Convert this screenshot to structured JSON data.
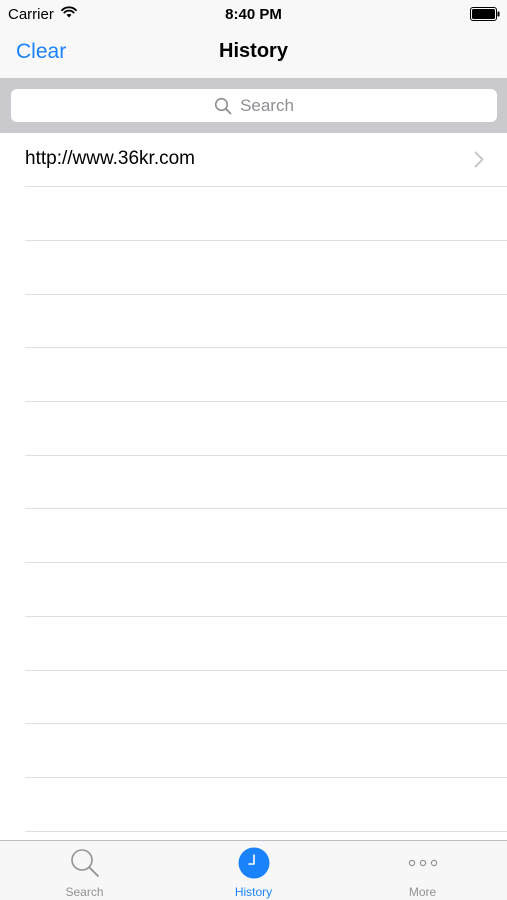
{
  "status_bar": {
    "carrier": "Carrier",
    "time": "8:40 PM"
  },
  "nav": {
    "left_button": "Clear",
    "title": "History"
  },
  "search": {
    "placeholder": "Search",
    "icon": "magnifier-icon"
  },
  "list": {
    "items": [
      {
        "text": "http://www.36kr.com",
        "accessory": "chevron-right-icon"
      }
    ],
    "empty_rows": 12
  },
  "tabs": [
    {
      "label": "Search",
      "icon": "magnifier-icon",
      "active": false
    },
    {
      "label": "History",
      "icon": "clock-icon",
      "active": true
    },
    {
      "label": "More",
      "icon": "more-dots-icon",
      "active": false
    }
  ],
  "colors": {
    "accent": "#1a82fb",
    "bar_background": "#f8f8f8",
    "search_background": "#c9c9ce",
    "inactive_tab": "#929292",
    "separator": "#e0e0e4"
  }
}
